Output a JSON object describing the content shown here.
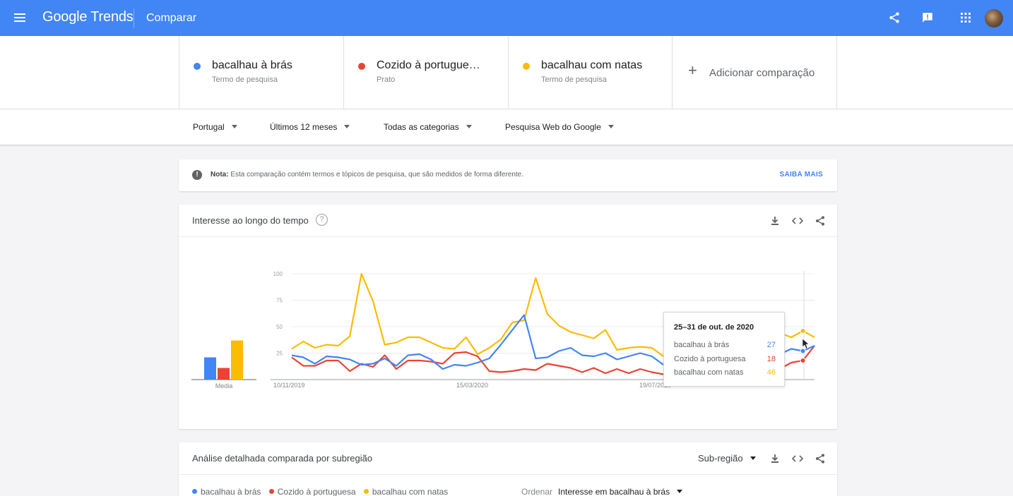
{
  "app": {
    "logo_text": "Google Trends",
    "page_title": "Comparar"
  },
  "terms": [
    {
      "name": "bacalhau à brás",
      "type": "Termo de pesquisa",
      "color": "#4285f4"
    },
    {
      "name": "Cozido à portugue…",
      "type": "Prato",
      "color": "#ea4335"
    },
    {
      "name": "bacalhau com natas",
      "type": "Termo de pesquisa",
      "color": "#fbbc04"
    }
  ],
  "add_comparison": {
    "icon": "plus-icon",
    "label": "Adicionar comparação"
  },
  "filters": {
    "region": "Portugal",
    "period": "Últimos 12 meses",
    "category": "Todas as categorias",
    "source": "Pesquisa Web do Google"
  },
  "note": {
    "label": "Nota:",
    "text": "Esta comparação contém termos e tópicos de pesquisa, que são medidos de forma diferente.",
    "link": "SAIBA MAIS"
  },
  "interest_card": {
    "title": "Interesse ao longo do tempo",
    "help": "?",
    "average_label": "Media"
  },
  "tooltip": {
    "title": "25–31 de out. de 2020",
    "rows": [
      {
        "label": "bacalhau à brás",
        "value": "27",
        "color": "#4285f4"
      },
      {
        "label": "Cozido à portuguesa",
        "value": "18",
        "color": "#ea4335"
      },
      {
        "label": "bacalhau com natas",
        "value": "46",
        "color": "#fbbc04"
      }
    ]
  },
  "chart_data": {
    "type": "line",
    "y_ticks": [
      "100",
      "75",
      "50",
      "25"
    ],
    "ylim": [
      0,
      100
    ],
    "x_tick_labels": [
      "10/11/2019",
      "15/03/2020",
      "19/07/2020"
    ],
    "grid": true,
    "averages": [
      {
        "name": "bacalhau à brás",
        "value": 21,
        "color": "#4285f4"
      },
      {
        "name": "Cozido à portuguesa",
        "value": 11,
        "color": "#ea4335"
      },
      {
        "name": "bacalhau com natas",
        "value": 37,
        "color": "#fbbc04"
      }
    ],
    "series": [
      {
        "name": "bacalhau à brás",
        "color": "#4285f4",
        "values": [
          23,
          21,
          15,
          22,
          21,
          19,
          14,
          15,
          20,
          13,
          23,
          24,
          19,
          10,
          14,
          13,
          16,
          20,
          33,
          47,
          61,
          20,
          21,
          27,
          30,
          23,
          22,
          25,
          19,
          22,
          25,
          22,
          14,
          17,
          10,
          21,
          20,
          22,
          25,
          28,
          24,
          27,
          24,
          29,
          27,
          32
        ]
      },
      {
        "name": "Cozido à portuguesa",
        "color": "#ea4335",
        "values": [
          21,
          13,
          13,
          18,
          18,
          8,
          15,
          12,
          23,
          10,
          18,
          18,
          17,
          15,
          25,
          26,
          22,
          8,
          7,
          8,
          10,
          9,
          15,
          13,
          11,
          7,
          11,
          6,
          10,
          6,
          10,
          7,
          5,
          5,
          5,
          6,
          5,
          4,
          5,
          6,
          9,
          7,
          10,
          16,
          18,
          32
        ]
      },
      {
        "name": "bacalhau com natas",
        "color": "#fbbc04",
        "values": [
          29,
          36,
          30,
          33,
          32,
          41,
          100,
          74,
          33,
          35,
          40,
          40,
          35,
          30,
          29,
          40,
          24,
          30,
          38,
          54,
          56,
          96,
          62,
          51,
          45,
          42,
          39,
          47,
          28,
          30,
          31,
          30,
          22,
          27,
          26,
          30,
          23,
          27,
          34,
          38,
          40,
          42,
          44,
          40,
          46,
          40
        ]
      }
    ]
  },
  "subregion_card": {
    "title": "Análise detalhada comparada por subregião",
    "select_label": "Sub-região",
    "legend": [
      "bacalhau à brás",
      "Cozido à portuguesa",
      "bacalhau com natas"
    ],
    "order_label": "Ordenar",
    "order_value": "Interesse em bacalhau à brás"
  }
}
